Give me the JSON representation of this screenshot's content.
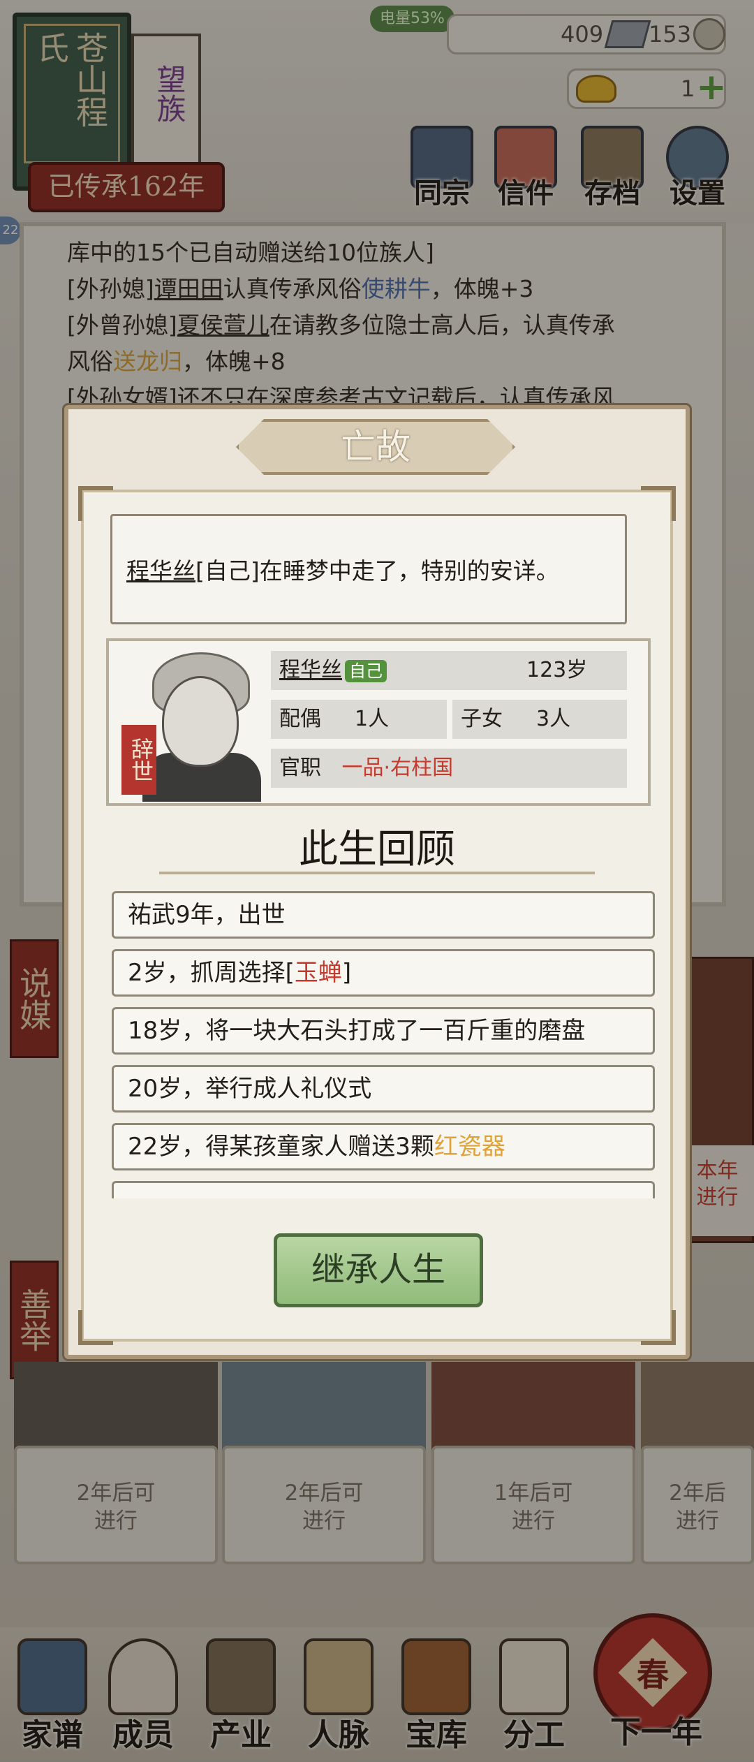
{
  "status": {
    "battery": "电量53%"
  },
  "resources": {
    "silver": "409",
    "copper": "153",
    "gold": "1"
  },
  "clan": {
    "name": "苍山程氏",
    "rank": "望族",
    "heritage": "已传承162年"
  },
  "top_buttons": [
    {
      "label": "同宗",
      "icon": "clan-book-icon"
    },
    {
      "label": "信件",
      "icon": "letter-icon"
    },
    {
      "label": "存档",
      "icon": "scroll-brush-icon"
    },
    {
      "label": "设置",
      "icon": "gear-icon"
    }
  ],
  "side_badge": "22",
  "log_lines": {
    "l0": "库中的15个已自动赠送给10位族人]",
    "l1_pre": "[外孙媳]",
    "l1_name": "谭田田",
    "l1_mid": "认真传承风俗",
    "l1_custom": "使耕牛",
    "l1_post": "，体魄+3",
    "l2_pre": "[外曾孙媳]",
    "l2_name": "夏侯萱儿",
    "l2_mid": "在请教多位隐士高人后，认真传承",
    "l2_mid2": "风俗",
    "l2_custom": "送龙归",
    "l2_post": "，体魄+8",
    "l3": "[外孙女婿]还不只在深度参考古文记载后，认真传承风"
  },
  "side_banners": {
    "matchmaking": "说媒",
    "charity": "善举"
  },
  "right_card": {
    "line1": "本年",
    "line2": "进行"
  },
  "cards": [
    {
      "line1": "2年后可",
      "line2": "进行"
    },
    {
      "line1": "2年后可",
      "line2": "进行"
    },
    {
      "line1": "1年后可",
      "line2": "进行"
    },
    {
      "line1": "2年后",
      "line2": "进行"
    }
  ],
  "nav": [
    {
      "label": "家谱",
      "icon": "genealogy-book-icon"
    },
    {
      "label": "成员",
      "icon": "member-icon"
    },
    {
      "label": "产业",
      "icon": "building-icon"
    },
    {
      "label": "人脉",
      "icon": "network-icon"
    },
    {
      "label": "宝库",
      "icon": "treasure-chest-icon"
    },
    {
      "label": "分工",
      "icon": "scroll-icon"
    },
    {
      "label": "下一年",
      "icon": "spring-lantern-icon"
    }
  ],
  "next_year_glyph": "春",
  "modal": {
    "title": "亡故",
    "message_name": "程华丝",
    "message_rest": "[自己]在睡梦中走了，特别的安详。",
    "person": {
      "name": "程华丝",
      "self_tag": "自己",
      "age": "123岁",
      "spouse_label": "配偶",
      "spouse_value": "1人",
      "children_label": "子女",
      "children_value": "3人",
      "office_label": "官职",
      "office_value": "一品·右柱国",
      "seal": "辞世"
    },
    "review_title": "此生回顾",
    "events": [
      {
        "pre": "祐武9年，出世",
        "hl": "",
        "post": "",
        "color": ""
      },
      {
        "pre": "2岁，抓周选择[",
        "hl": "玉蝉",
        "post": "]",
        "color": "#c63a2e"
      },
      {
        "pre": "18岁，将一块大石头打成了一百斤重的磨盘",
        "hl": "",
        "post": "",
        "color": ""
      },
      {
        "pre": "20岁，举行成人礼仪式",
        "hl": "",
        "post": "",
        "color": ""
      },
      {
        "pre": "22岁，得某孩童家人赠送3颗",
        "hl": "红瓷器",
        "post": "",
        "color": "#e0a33a"
      }
    ],
    "continue_button": "继承人生"
  }
}
